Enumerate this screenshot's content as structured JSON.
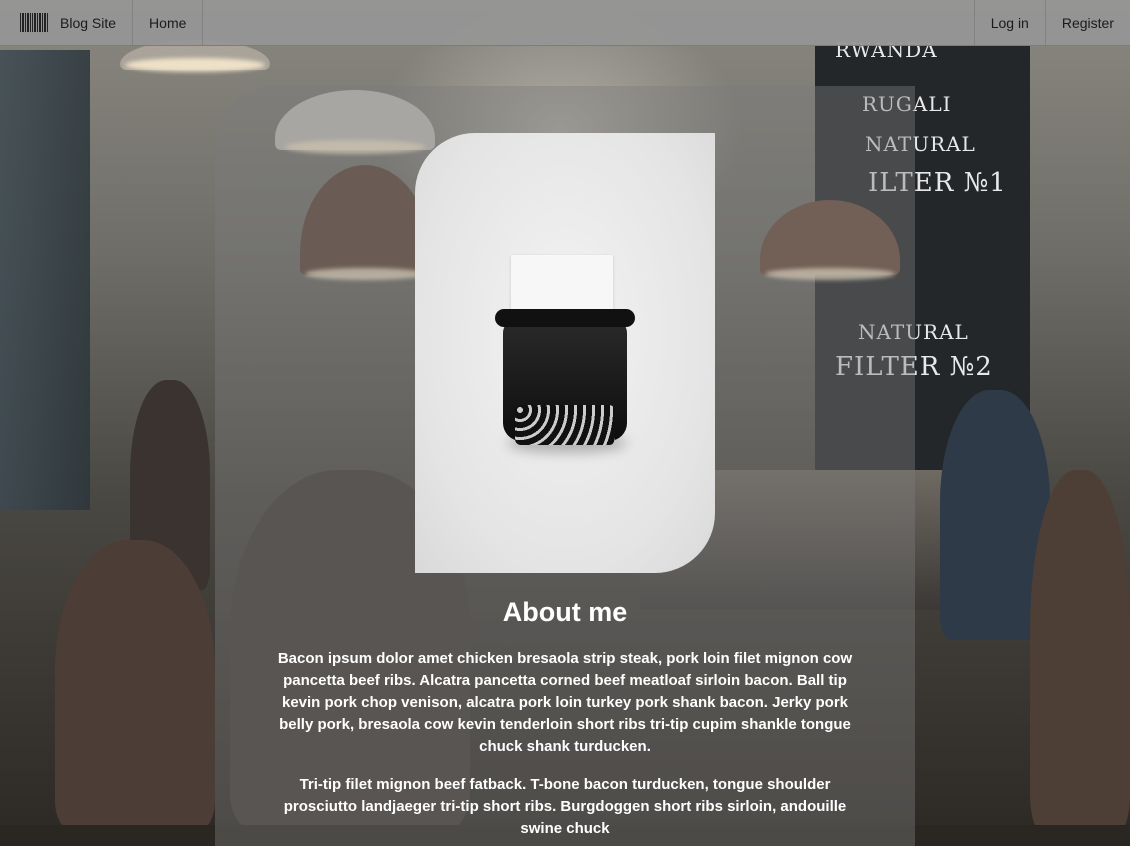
{
  "navbar": {
    "brand_label": "Blog Site",
    "home_label": "Home",
    "login_label": "Log in",
    "register_label": "Register"
  },
  "about": {
    "title": "About me",
    "paragraphs": [
      "Bacon ipsum dolor amet chicken bresaola strip steak, pork loin filet mignon cow pancetta beef ribs. Alcatra pancetta corned beef meatloaf sirloin bacon. Ball tip kevin pork chop venison, alcatra pork loin turkey pork shank bacon. Jerky pork belly pork, bresaola cow kevin tenderloin short ribs tri-tip cupim shankle tongue chuck shank turducken.",
      "Tri-tip filet mignon beef fatback. T-bone bacon turducken, tongue shoulder prosciutto landjaeger tri-tip short ribs. Burgdoggen short ribs sirloin, andouille swine chuck"
    ]
  },
  "colors": {
    "navbar_bg": "#969696",
    "text_on_card": "#ffffff"
  },
  "icons": {
    "brand": "barcode-icon"
  }
}
